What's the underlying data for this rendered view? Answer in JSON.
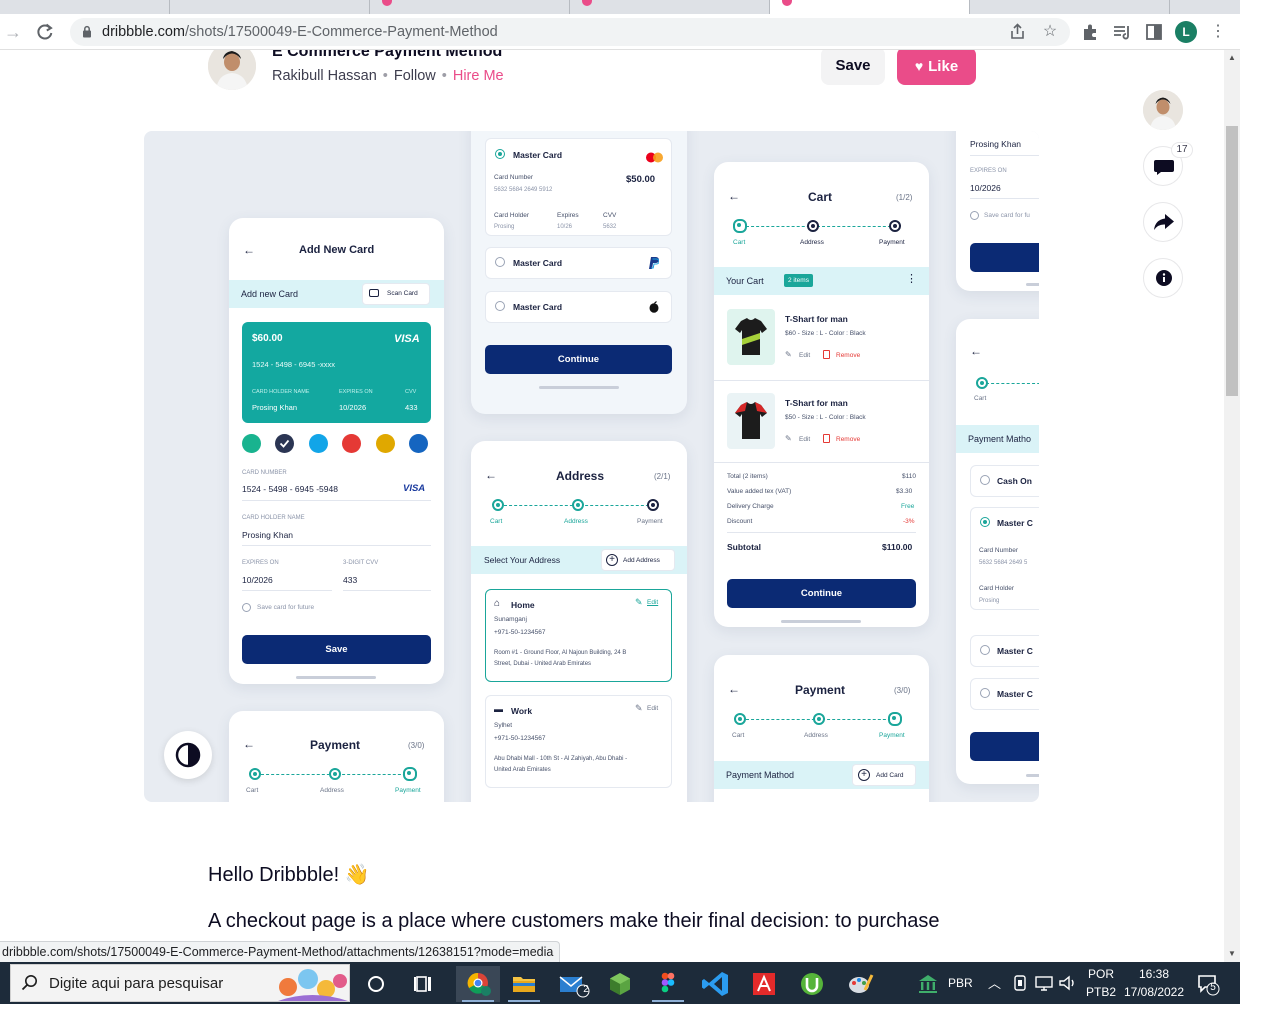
{
  "browser": {
    "url_host": "dribbble.com",
    "url_path": "/shots/17500049-E-Commerce-Payment-Method",
    "profile_initial": "L",
    "status_url": "dribbble.com/shots/17500049-E-Commerce-Payment-Method/attachments/12638151?mode=media"
  },
  "shot_header": {
    "title": "E Commerce Payment Method",
    "author": "Rakibull Hassan",
    "follow_label": "Follow",
    "hire_label": "Hire Me",
    "save_label": "Save",
    "like_label": "Like",
    "comment_count": "17"
  },
  "description": {
    "greeting": "Hello Dribbble! 👋",
    "body": "A checkout page is a place where customers make their final decision: to purchase"
  },
  "mockup": {
    "add_card": {
      "title": "Add New Card",
      "band_label": "Add new Card",
      "scan_label": "Scan Card",
      "card_amount": "$60.00",
      "card_brand": "VISA",
      "card_number_masked": "1524 - 5498 - 6945 -xxxx",
      "holder_label": "CARD HOLDER NAME",
      "expires_label": "EXPIRES ON",
      "cvv_label": "CVV",
      "holder_value": "Prosing Khan",
      "expires_value": "10/2026",
      "cvv_value": "433",
      "swatch_colors": [
        "#19b38f",
        "#2b3553",
        "#12a5e8",
        "#e53935",
        "#e0a800",
        "#1565c0"
      ],
      "card_number_label": "CARD NUMBER",
      "card_number_value": "1524 - 5498 - 6945 -5948",
      "holder_name_label": "CARD HOLDER NAME",
      "holder_name_value": "Prosing Khan",
      "expires_on_label": "EXPIRES ON",
      "expires_on_value": "10/2026",
      "cvv_digit_label": "3-DIGIT CVV",
      "cvv_digit_value": "433",
      "save_card_label": "Save card for future",
      "save_label": "Save"
    },
    "payment_small": {
      "title": "Payment",
      "step": "(3/0)",
      "steps": [
        "Cart",
        "Address",
        "Payment"
      ]
    },
    "methods": {
      "option1_label": "Master Card",
      "card_number_label": "Card Number",
      "card_number_value": "5632 5684 2649 5912",
      "amount": "$50.00",
      "holder_label": "Card Holder",
      "holder_value": "Prosing",
      "expires_label": "Expires",
      "expires_value": "10/26",
      "cvv_label": "CVV",
      "cvv_value": "5632",
      "option2_label": "Master Card",
      "option3_label": "Master Card",
      "continue_label": "Continue"
    },
    "address": {
      "title": "Address",
      "step": "(2/1)",
      "steps": [
        "Cart",
        "Address",
        "Payment"
      ],
      "band_label": "Select Your Address",
      "add_label": "Add Address",
      "home_label": "Home",
      "home_city": "Sunamganj",
      "home_phone": "+971-50-1234567",
      "home_line1": "Room #1 - Ground Floor, Al Najoun Building, 24 B",
      "home_line2": "Street, Dubai - United Arab Emirates",
      "edit_label": "Edit",
      "work_label": "Work",
      "work_city": "Sylhet",
      "work_phone": "+971-50-1234567",
      "work_line1": "Abu Dhabi Mall - 10th St - Al Zahiyah, Abu Dhabi -",
      "work_line2": "United Arab Emirates",
      "work_edit_label": "Edit"
    },
    "cart": {
      "title": "Cart",
      "step": "(1/2)",
      "steps": [
        "Cart",
        "Address",
        "Payment"
      ],
      "band_label": "Your Cart",
      "items_badge": "2 items",
      "item1_name": "T-Shart for man",
      "item1_meta": "$60 - Size : L - Color : Black",
      "item2_name": "T-Shart for man",
      "item2_meta": "$50 - Size : L - Color : Black",
      "edit_label": "Edit",
      "remove_label": "Remove",
      "total_label": "Total (2 items)",
      "total_value": "$110",
      "vat_label": "Value added tex (VAT)",
      "vat_value": "$3.30",
      "delivery_label": "Delivery Charge",
      "delivery_value": "Free",
      "discount_label": "Discount",
      "discount_value": "-3%",
      "subtotal_label": "Subtotal",
      "subtotal_value": "$110.00",
      "continue_label": "Continue"
    },
    "payment": {
      "title": "Payment",
      "step": "(3/0)",
      "steps": [
        "Cart",
        "Address",
        "Payment"
      ],
      "band_label": "Payment Mathod",
      "add_label": "Add Card"
    },
    "right_top": {
      "holder": "Prosing Khan",
      "expires_label": "EXPIRES ON",
      "expires_value": "10/2026",
      "save_label": "Save card for fu"
    },
    "right_bottom": {
      "step_label": "Cart",
      "band_label": "Payment Matho",
      "cash_label": "Cash On",
      "master1_label": "Master C",
      "card_number_label": "Card Number",
      "card_number_value": "5632 5684 2649 5",
      "holder_label": "Card Holder",
      "holder_value": "Prosing",
      "master2_label": "Master C",
      "master3_label": "Master C"
    }
  },
  "taskbar": {
    "search_placeholder": "Digite aqui para pesquisar",
    "lang": "PBR",
    "keyboard_line1": "POR",
    "keyboard_line2": "PTB2",
    "time": "16:38",
    "date": "17/08/2022",
    "notification_count": "5",
    "mail_badge": "2"
  }
}
